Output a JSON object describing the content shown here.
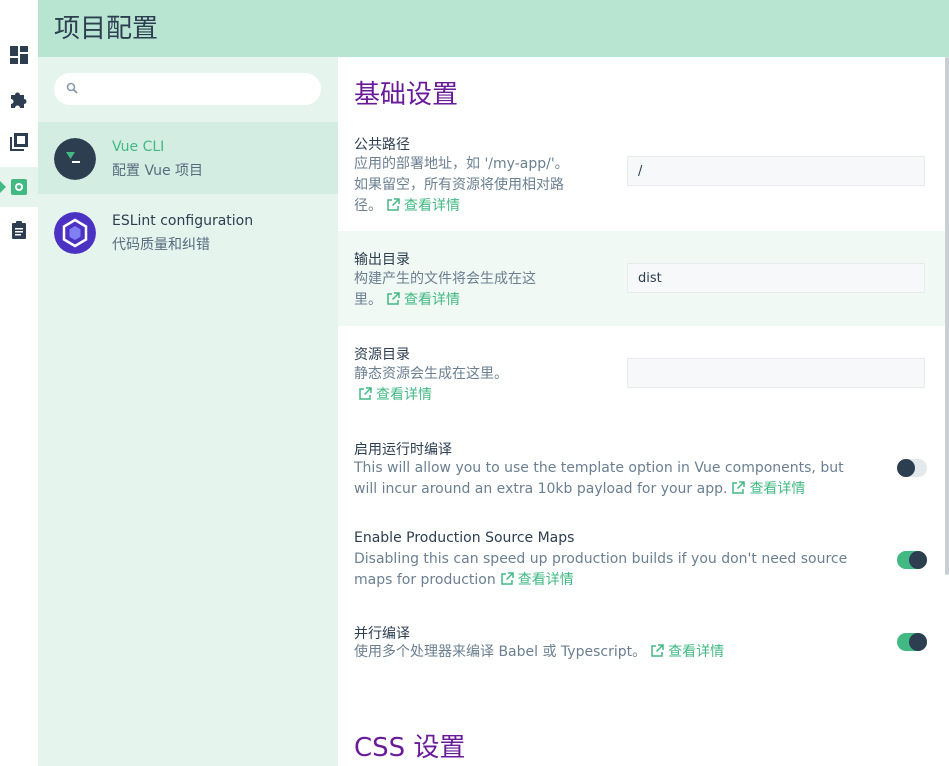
{
  "colors": {
    "accent": "#42b983",
    "header_bg": "#b8e4d2",
    "section_title": "#6a1b9a",
    "text": "#2c3e50"
  },
  "rail": {
    "items": [
      {
        "icon": "dashboard-icon"
      },
      {
        "icon": "puzzle-icon"
      },
      {
        "icon": "library-icon"
      },
      {
        "icon": "settings-icon",
        "active": true
      },
      {
        "icon": "clipboard-icon"
      }
    ]
  },
  "header": {
    "title": "项目配置"
  },
  "search": {
    "placeholder": "",
    "value": ""
  },
  "plugins": [
    {
      "name": "Vue CLI",
      "description": "配置 Vue 项目",
      "selected": true,
      "icon": "vue-cli-logo"
    },
    {
      "name": "ESLint configuration",
      "description": "代码质量和纠错",
      "selected": false,
      "icon": "eslint-logo"
    }
  ],
  "config": {
    "sections": [
      {
        "title": "基础设置"
      },
      {
        "title": "CSS 设置"
      }
    ],
    "more_label": "查看详情",
    "prompts": [
      {
        "name": "公共路径",
        "desc1": "应用的部署地址，如 '/my-app/'。",
        "desc2": "如果留空，所有资源将使用相对路",
        "desc3": "径。",
        "value": "/"
      },
      {
        "name": "输出目录",
        "desc1": "构建产生的文件将会生成在这",
        "desc2": "里。",
        "value": "dist"
      },
      {
        "name": "资源目录",
        "desc1": "静态资源会生成在这里。",
        "value": ""
      },
      {
        "name": "启用运行时编译",
        "desc1": "This will allow you to use the template option in Vue components, but",
        "desc2": "will incur around an extra 10kb payload for your app.",
        "enabled": false
      },
      {
        "name": "Enable Production Source Maps",
        "desc1": "Disabling this can speed up production builds if you don't need source",
        "desc2": "maps for production",
        "enabled": true
      },
      {
        "name": "并行编译",
        "desc1": "使用多个处理器来编译 Babel 或 Typescript。",
        "enabled": true
      }
    ]
  }
}
